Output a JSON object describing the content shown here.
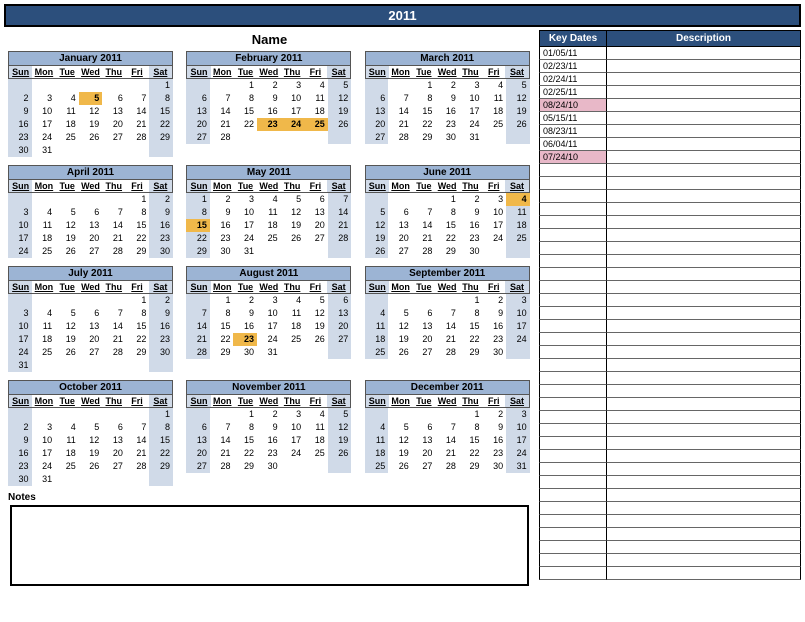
{
  "year": "2011",
  "name_label": "Name",
  "day_names": [
    "Sun",
    "Mon",
    "Tue",
    "Wed",
    "Thu",
    "Fri",
    "Sat"
  ],
  "months": [
    {
      "title": "January 2011",
      "start": 6,
      "count": 31,
      "hl": [
        5
      ]
    },
    {
      "title": "February 2011",
      "start": 2,
      "count": 28,
      "hl": [
        23,
        24,
        25
      ]
    },
    {
      "title": "March 2011",
      "start": 2,
      "count": 31,
      "hl": []
    },
    {
      "title": "April 2011",
      "start": 5,
      "count": 30,
      "hl": []
    },
    {
      "title": "May 2011",
      "start": 0,
      "count": 31,
      "hl": [
        15
      ]
    },
    {
      "title": "June 2011",
      "start": 3,
      "count": 30,
      "hl": [
        4
      ]
    },
    {
      "title": "July 2011",
      "start": 5,
      "count": 31,
      "hl": []
    },
    {
      "title": "August 2011",
      "start": 1,
      "count": 31,
      "hl": [
        23
      ]
    },
    {
      "title": "September 2011",
      "start": 4,
      "count": 30,
      "hl": []
    },
    {
      "title": "October 2011",
      "start": 6,
      "count": 31,
      "hl": []
    },
    {
      "title": "November 2011",
      "start": 2,
      "count": 30,
      "hl": []
    },
    {
      "title": "December 2011",
      "start": 4,
      "count": 31,
      "hl": []
    }
  ],
  "sidebar": {
    "key_dates_label": "Key Dates",
    "description_label": "Description",
    "total_rows": 41,
    "dates": [
      {
        "date": "01/05/11",
        "pink": false
      },
      {
        "date": "02/23/11",
        "pink": false
      },
      {
        "date": "02/24/11",
        "pink": false
      },
      {
        "date": "02/25/11",
        "pink": false
      },
      {
        "date": "08/24/10",
        "pink": true
      },
      {
        "date": "05/15/11",
        "pink": false
      },
      {
        "date": "08/23/11",
        "pink": false
      },
      {
        "date": "06/04/11",
        "pink": false
      },
      {
        "date": "07/24/10",
        "pink": true
      }
    ]
  },
  "notes_label": "Notes"
}
